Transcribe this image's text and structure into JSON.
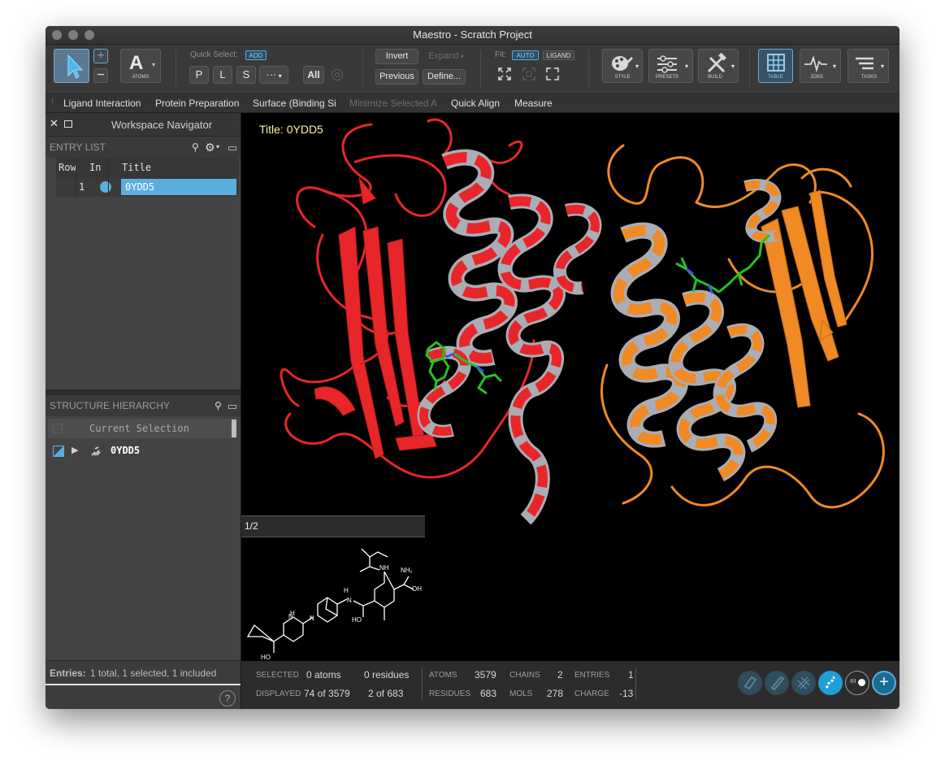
{
  "window": {
    "title": "Maestro - Scratch Project"
  },
  "toolbar": {
    "atoms_label": "ATOMS",
    "quick_select_label": "Quick Select:",
    "add_label": "ADD",
    "p_label": "P",
    "l_label": "L",
    "s_label": "S",
    "more_label": "···",
    "all_label": "All",
    "invert_label": "Invert",
    "expand_label": "Expand",
    "previous_label": "Previous",
    "define_label": "Define...",
    "fit_label": "Fit:",
    "auto_label": "AUTO",
    "ligand_label": "LIGAND",
    "style_label": "STYLE",
    "presets_label": "PRESETS",
    "build_label": "BUILD",
    "table_label": "TABLE",
    "jobs_label": "JOBS",
    "tasks_label": "TASKS"
  },
  "function_bar": {
    "items": [
      "Ligand Interaction",
      "Protein Preparation",
      "Surface (Binding Si",
      "Minimize Selected A",
      "Quick Align",
      "Measure"
    ]
  },
  "navigator": {
    "title": "Workspace Navigator",
    "entry_list_label": "ENTRY LIST",
    "columns": {
      "row": "Row",
      "in": "In",
      "title": "Title"
    },
    "entries": [
      {
        "row": "1",
        "title": "0YDD5"
      }
    ],
    "structure_hierarchy_label": "STRUCTURE HIERARCHY",
    "current_selection": "Current Selection",
    "hierarchy_item": "0YDD5",
    "footer_label": "Entries:",
    "footer_text": "1 total, 1 selected, 1 included",
    "help_label": "?"
  },
  "workspace": {
    "title": "Title: 0YDD5",
    "ligand_page": "1/2",
    "colors": {
      "chain_a": "#e8262a",
      "chain_b": "#f08a25",
      "ligand": "#22c323",
      "helix_inner": "#a9adb6",
      "nitrogen": "#3a4cff"
    }
  },
  "status": {
    "selected_label": "SELECTED",
    "selected_atoms": "0 atoms",
    "selected_residues": "0 residues",
    "displayed_label": "DISPLAYED",
    "displayed_atoms": "74 of 3579",
    "displayed_residues": "2 of 683",
    "atoms_label": "ATOMS",
    "atoms_value": "3579",
    "chains_label": "CHAINS",
    "chains_value": "2",
    "entries_label": "ENTRIES",
    "entries_value": "1",
    "residues_label": "RESIDUES",
    "residues_value": "683",
    "mols_label": "MOLS",
    "mols_value": "278",
    "charge_label": "CHARGE",
    "charge_value": "-13"
  },
  "accent_color": "#5aaede"
}
